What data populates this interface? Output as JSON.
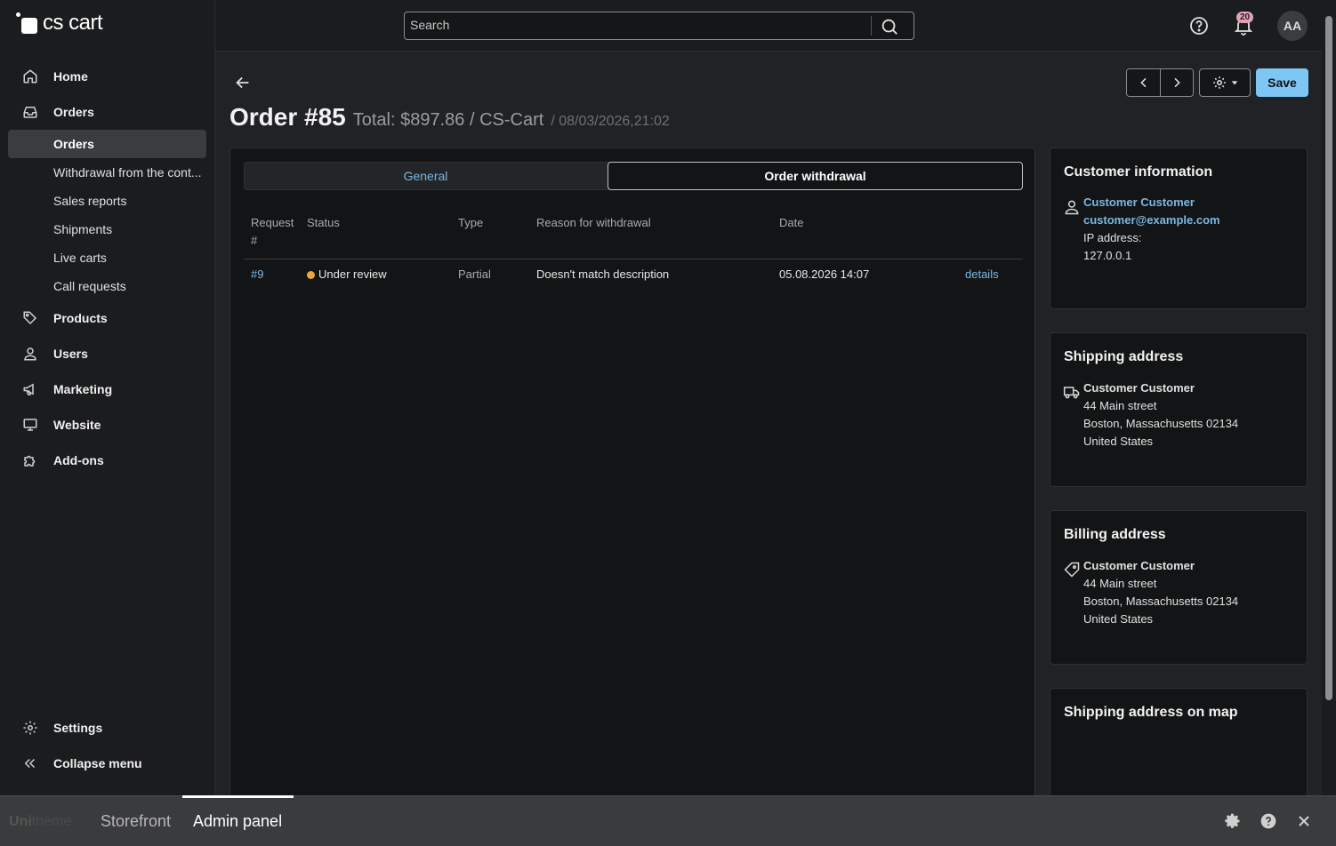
{
  "brand": {
    "name": "cs cart"
  },
  "sidebar": {
    "items": [
      {
        "label": "Home",
        "icon": "home-icon"
      },
      {
        "label": "Orders",
        "icon": "inbox-icon"
      }
    ],
    "orders_sub": [
      "Orders",
      "Withdrawal from the cont...",
      "Sales reports",
      "Shipments",
      "Live carts",
      "Call requests"
    ],
    "items2": [
      {
        "label": "Products",
        "icon": "tag-icon"
      },
      {
        "label": "Users",
        "icon": "user-icon"
      },
      {
        "label": "Marketing",
        "icon": "megaphone-icon"
      },
      {
        "label": "Website",
        "icon": "monitor-icon"
      },
      {
        "label": "Add-ons",
        "icon": "puzzle-icon"
      }
    ],
    "bottom": [
      {
        "label": "Settings",
        "icon": "gear-icon"
      },
      {
        "label": "Collapse menu",
        "icon": "double-chevron-left-icon"
      }
    ]
  },
  "topbar": {
    "search_placeholder": "Search",
    "notifications_count": "20",
    "avatar_initials": "AA"
  },
  "page": {
    "title": "Order #85",
    "total": "Total: $897.86 / CS-Cart",
    "date": "/ 08/03/2026,21:02",
    "save_label": "Save"
  },
  "tabs": {
    "general": "General",
    "withdrawal": "Order withdrawal"
  },
  "table": {
    "headers": {
      "request_line1": "Request",
      "request_line2": "#",
      "status": "Status",
      "type": "Type",
      "reason": "Reason for withdrawal",
      "date": "Date"
    },
    "rows": [
      {
        "request": "#9",
        "status": "Under review",
        "status_color": "#f0a53a",
        "type": "Partial",
        "reason": "Doesn't match description",
        "date": "05.08.2026 14:07",
        "action": "details"
      }
    ]
  },
  "customer": {
    "title": "Customer information",
    "name": "Customer Customer",
    "email": "customer@example.com",
    "ip_label": "IP address:",
    "ip": "127.0.0.1"
  },
  "shipping": {
    "title": "Shipping address",
    "name": "Customer Customer",
    "street": "44 Main street",
    "city": "Boston, Massachusetts 02134",
    "country": "United States"
  },
  "billing": {
    "title": "Billing address",
    "name": "Customer Customer",
    "street": "44 Main street",
    "city": "Boston, Massachusetts 02134",
    "country": "United States"
  },
  "map": {
    "title": "Shipping address on map"
  },
  "bottombar": {
    "brand_a": "Uni",
    "brand_b": "theme",
    "storefront": "Storefront",
    "admin": "Admin panel"
  },
  "colors": {
    "accent": "#7ec6f4",
    "link": "#7ab8e6",
    "badge": "#e5a0b8"
  }
}
